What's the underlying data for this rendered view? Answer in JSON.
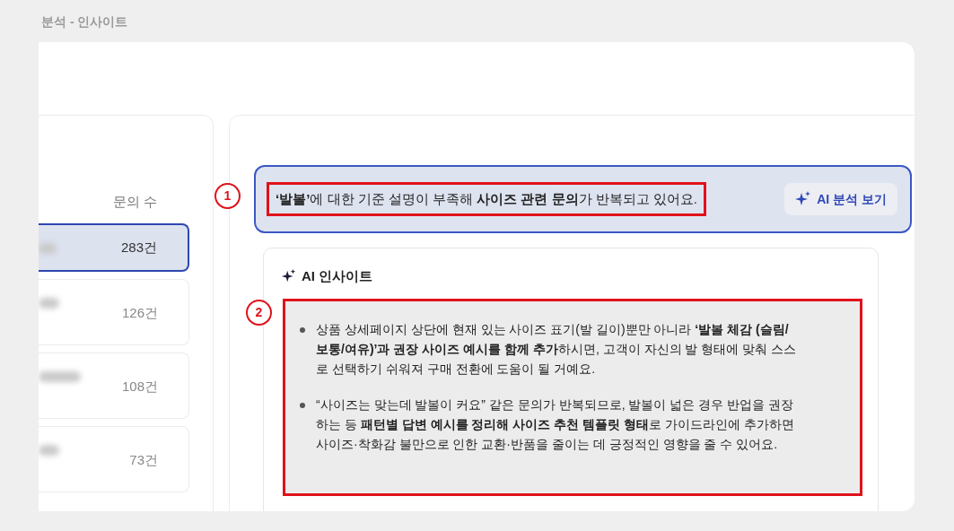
{
  "window": {
    "title": "분석 - 인사이트"
  },
  "list": {
    "column_header": "문의 수",
    "rows": [
      {
        "count": "283건",
        "selected": true
      },
      {
        "count": "126건",
        "selected": false
      },
      {
        "count": "108건",
        "selected": false
      },
      {
        "count": "73건",
        "selected": false
      }
    ]
  },
  "banner": {
    "text": "**‘발볼’**에 대한 기준 설명이 부족해 **사이즈 관련 문의**가 반복되고 있어요.",
    "button": "AI 분석 보기"
  },
  "insight": {
    "title": "AI 인사이트",
    "bullets": [
      "상품 상세페이지 상단에 현재 있는 사이즈 표기(발 길이)뿐만 아니라 **‘발볼 체감 (슬림/보통/여유)’과 권장 사이즈 예시를 함께 추가**하시면, 고객이 자신의 발 형태에 맞춰 스스로 선택하기 쉬워져 구매 전환에 도움이 될 거예요.",
      "“사이즈는 맞는데 발볼이 커요” 같은 문의가 반복되므로, 발볼이 넓은 경우 반업을 권장하는 등 **패턴별 답변 예시를 정리해 사이즈 추천 템플릿 형태**로 가이드라인에 추가하면 사이즈·착화감 불만으로 인한 교환·반품을 줄이는 데 긍정적인 영향을 줄 수 있어요."
    ]
  },
  "annotations": [
    {
      "label": "1"
    },
    {
      "label": "2"
    }
  ]
}
